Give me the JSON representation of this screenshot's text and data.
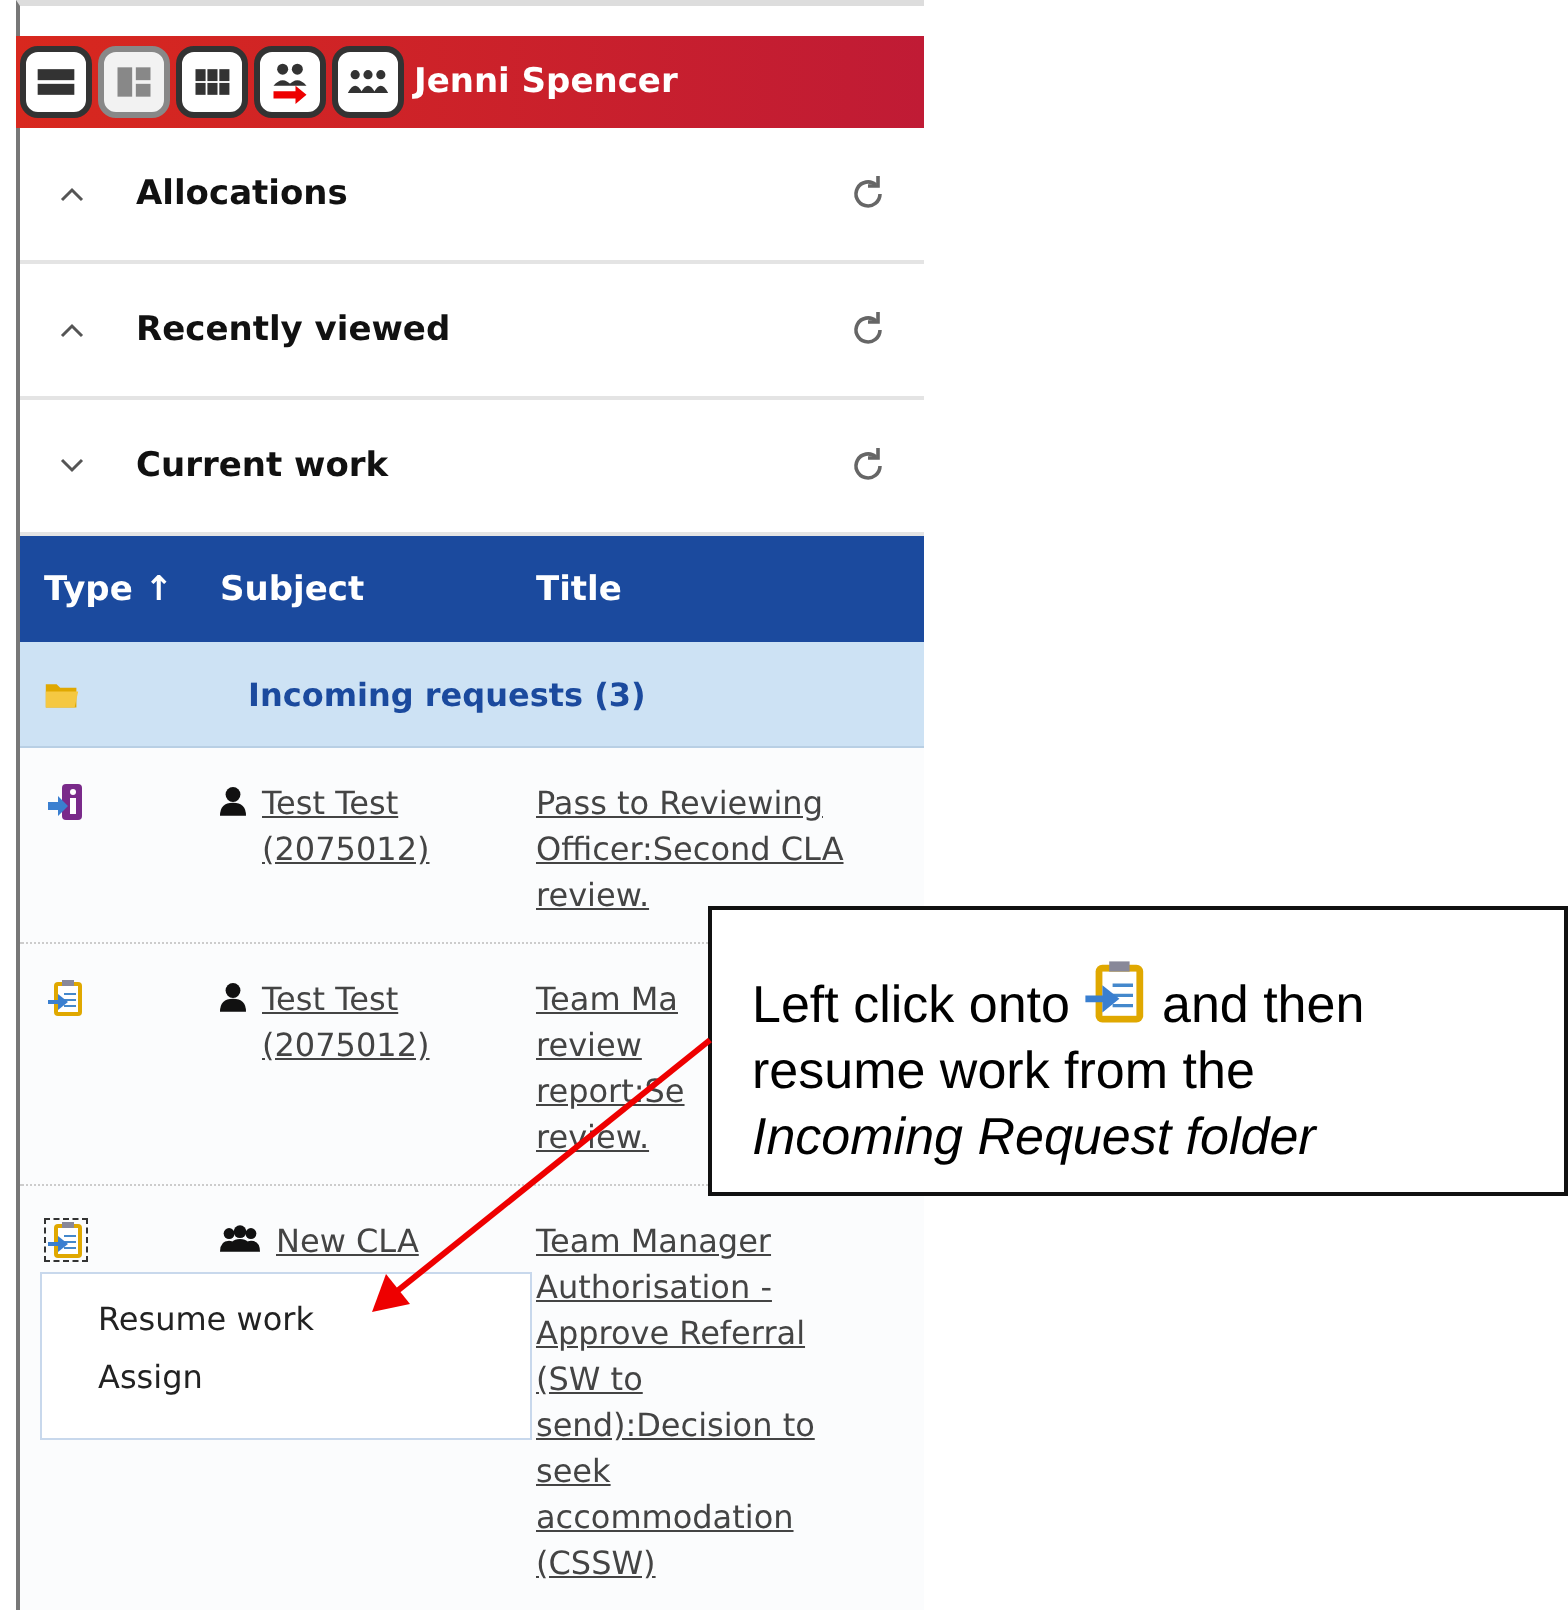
{
  "header": {
    "buttons": [
      {
        "kind": "single",
        "selected": false
      },
      {
        "kind": "split",
        "selected": true
      },
      {
        "kind": "grid",
        "selected": false
      },
      {
        "kind": "transfer",
        "selected": false
      },
      {
        "kind": "team",
        "selected": false
      }
    ],
    "user": "Jenni Spencer"
  },
  "sections": [
    {
      "title": "Allocations",
      "expanded": false
    },
    {
      "title": "Recently viewed",
      "expanded": false
    },
    {
      "title": "Current work",
      "expanded": true
    }
  ],
  "table": {
    "columns": [
      "Type ↑",
      "Subject",
      "Title"
    ],
    "folder": {
      "label": "Incoming requests (3)"
    },
    "rows": [
      {
        "kind": "info",
        "subject": {
          "kind": "person",
          "lines": [
            "Test Test",
            "(2075012)"
          ]
        },
        "title": [
          "Pass to Reviewing",
          "Officer:Second CLA",
          "review."
        ],
        "focused": false
      },
      {
        "kind": "clipboard",
        "subject": {
          "kind": "person",
          "lines": [
            "Test Test",
            "(2075012)"
          ]
        },
        "title": [
          "Team Ma",
          "review",
          "report:Se",
          "review."
        ],
        "focused": false
      },
      {
        "kind": "clipboard",
        "subject": {
          "kind": "group",
          "lines": [
            "New CLA"
          ]
        },
        "title": [
          "Team Manager",
          "Authorisation -",
          "Approve Referral",
          "(SW to",
          "send):Decision to",
          "seek",
          "accommodation",
          "(CSSW)"
        ],
        "focused": true
      }
    ]
  },
  "menu": [
    "Resume work",
    "Assign"
  ],
  "callout": {
    "before": "Left click onto",
    "after": "and then",
    "rest": "resume work from the *Incoming Request folder*"
  }
}
